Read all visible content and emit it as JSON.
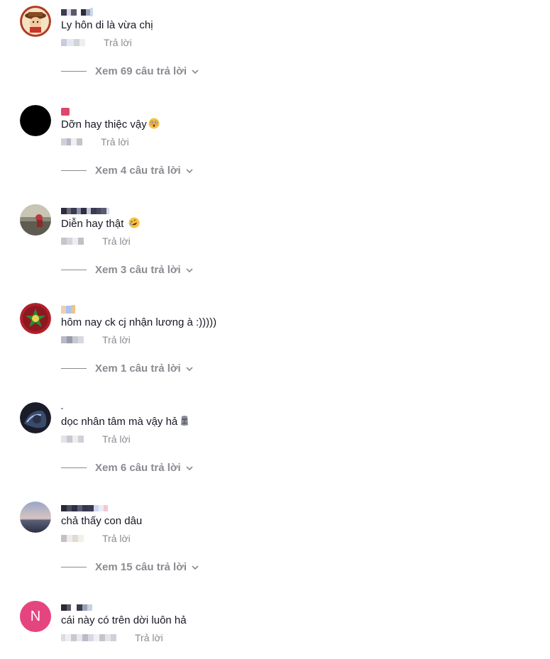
{
  "reply_label": "Trả lời",
  "comments": [
    {
      "text": "Ly hôn di là vừa chị",
      "view_replies": "Xem 69 câu trả lời",
      "avatar_icon": "cartoon-avatar-icon"
    },
    {
      "text": "Dỡn hay thiệc vậy",
      "emoji": "astonished-face-emoji",
      "view_replies": "Xem 4 câu trả lời",
      "avatar_icon": "black-avatar-icon"
    },
    {
      "text": "Diễn hay thật ",
      "emoji": "rofl-emoji",
      "view_replies": "Xem 3 câu trả lời",
      "avatar_icon": "photo-avatar-icon"
    },
    {
      "text": "hôm nay ck cj nhận lương à :)))))",
      "view_replies": "Xem 1 câu trả lời",
      "avatar_icon": "star-flag-avatar-icon"
    },
    {
      "text": "dọc nhân tâm mà vậy hả",
      "emoji": "moai-emoji",
      "view_replies": "Xem 6 câu trả lời",
      "avatar_icon": "dark-photo-avatar-icon"
    },
    {
      "text": "chả thấy con dâu",
      "view_replies": "Xem 15 câu trả lời",
      "avatar_icon": "sunset-avatar-icon"
    },
    {
      "text": "cái này có trên dời luôn hả",
      "avatar_letter": "N",
      "avatar_icon": "letter-avatar-icon"
    }
  ],
  "colors": {
    "text": "#161823",
    "muted": "#8a8b91",
    "letter_avatar_bg": "#e5457f"
  }
}
